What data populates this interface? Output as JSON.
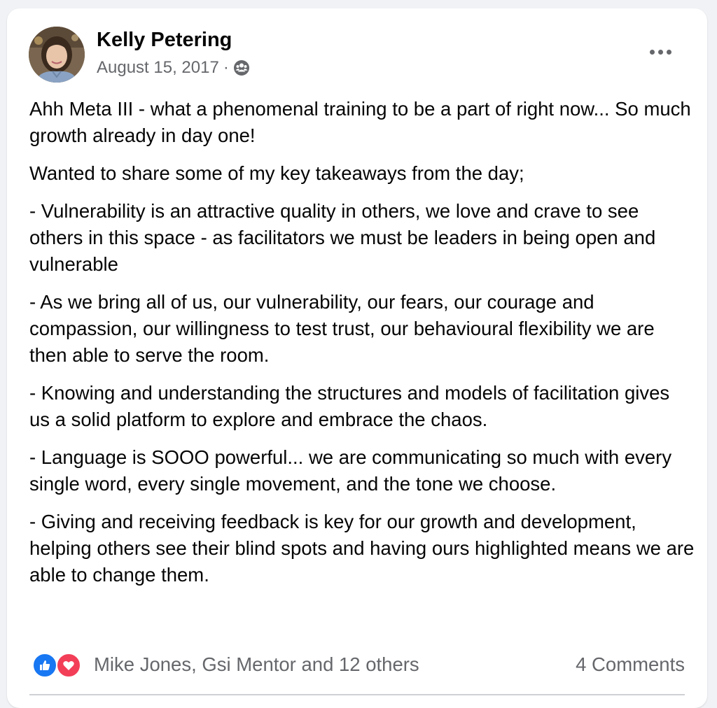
{
  "post": {
    "author": "Kelly Petering",
    "date": "August 15, 2017",
    "separator": "·",
    "audience_icon": "group-icon",
    "more_icon": "more-options-icon",
    "paragraphs": [
      "Ahh Meta III - what a phenomenal training to be a part of right now... So much growth already in day one!",
      "Wanted to share some of my key takeaways from the day;",
      "- Vulnerability is an attractive quality in others, we love and crave to see others in this space - as facilitators we must be leaders in being open and vulnerable",
      "- As we bring all of us, our vulnerability, our fears, our courage and compassion, our willingness to test trust, our behavioural flexibility we are then able to serve the room.",
      "- Knowing and understanding the structures and models of facilitation gives us a solid platform to explore and embrace the chaos.",
      "- Language is SOOO powerful... we are communicating so much with every single word, every single movement, and the tone we choose.",
      "- Giving and receiving feedback is key for our growth and development, helping others see their blind spots and having ours highlighted means we are able to change them."
    ]
  },
  "footer": {
    "reaction_icons": [
      "like-icon",
      "love-icon"
    ],
    "reaction_names": "Mike Jones, Gsi Mentor and 12 others",
    "comments": "4 Comments"
  },
  "colors": {
    "like": "#1877f2",
    "love": "#f33e58",
    "secondary_text": "#65676b",
    "primary_text": "#050505"
  }
}
